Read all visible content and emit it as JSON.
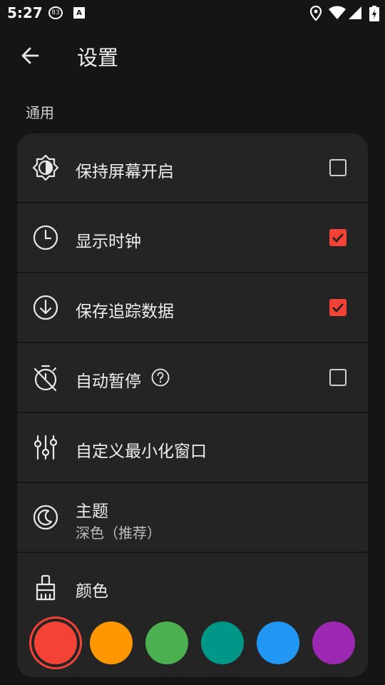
{
  "status_bar": {
    "time": "5:27",
    "badge": "83",
    "keyboard_badge": "A"
  },
  "app_bar": {
    "title": "设置"
  },
  "section": {
    "title": "通用"
  },
  "settings": [
    {
      "label": "保持屏幕开启",
      "icon": "brightness-icon",
      "checked": false
    },
    {
      "label": "显示时钟",
      "icon": "clock-icon",
      "checked": true
    },
    {
      "label": "保存追踪数据",
      "icon": "download-icon",
      "checked": true
    },
    {
      "label": "自动暂停",
      "icon": "timer-off-icon",
      "checked": false
    },
    {
      "label": "自定义最小化窗口",
      "icon": "sliders-icon"
    },
    {
      "label": "主题",
      "sublabel": "深色（推荐）",
      "icon": "moon-icon"
    },
    {
      "label": "颜色",
      "icon": "brush-icon"
    }
  ],
  "colors": {
    "accent": "#f44336",
    "swatches": [
      "#f44336",
      "#ff9800",
      "#4caf50",
      "#009688",
      "#2196f3",
      "#9c27b0"
    ],
    "selected_index": 0
  }
}
